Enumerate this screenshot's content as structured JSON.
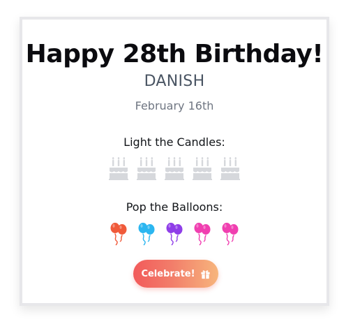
{
  "card": {
    "title": "Happy 28th Birthday!",
    "name": "DANISH",
    "date": "February 16th"
  },
  "candles": {
    "label": "Light the Candles:",
    "count": 5,
    "icon": "cake-icon",
    "color": "#d6d8dc"
  },
  "balloons": {
    "label": "Pop the Balloons:",
    "icon": "balloon-icon",
    "colors": [
      "#f05a3a",
      "#2bb6f0",
      "#8f3ee8",
      "#f03fb0",
      "#f03fb0"
    ]
  },
  "button": {
    "label": "Celebrate!",
    "icon": "gift-icon",
    "gradient": [
      "#f25a5a",
      "#f7b57c"
    ]
  }
}
